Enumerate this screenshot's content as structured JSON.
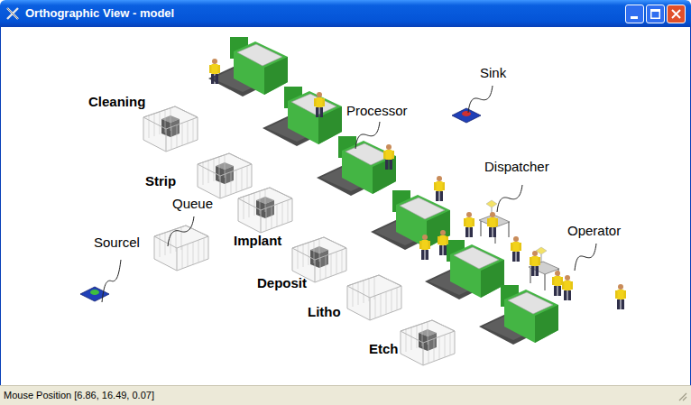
{
  "window": {
    "title": "Orthographic View - model"
  },
  "labels": [
    {
      "text": "Cleaning",
      "kind": "bold"
    },
    {
      "text": "Strip",
      "kind": "bold"
    },
    {
      "text": "Queue",
      "kind": "callout"
    },
    {
      "text": "Sourcel",
      "kind": "callout"
    },
    {
      "text": "Implant",
      "kind": "bold"
    },
    {
      "text": "Deposit",
      "kind": "bold"
    },
    {
      "text": "Litho",
      "kind": "bold"
    },
    {
      "text": "Etch",
      "kind": "bold"
    },
    {
      "text": "Processor",
      "kind": "callout"
    },
    {
      "text": "Sink",
      "kind": "callout"
    },
    {
      "text": "Dispatcher",
      "kind": "callout"
    },
    {
      "text": "Operator",
      "kind": "callout"
    }
  ],
  "status_bar": {
    "text": "Mouse Position [6.86, 16.49, 0.07]"
  }
}
